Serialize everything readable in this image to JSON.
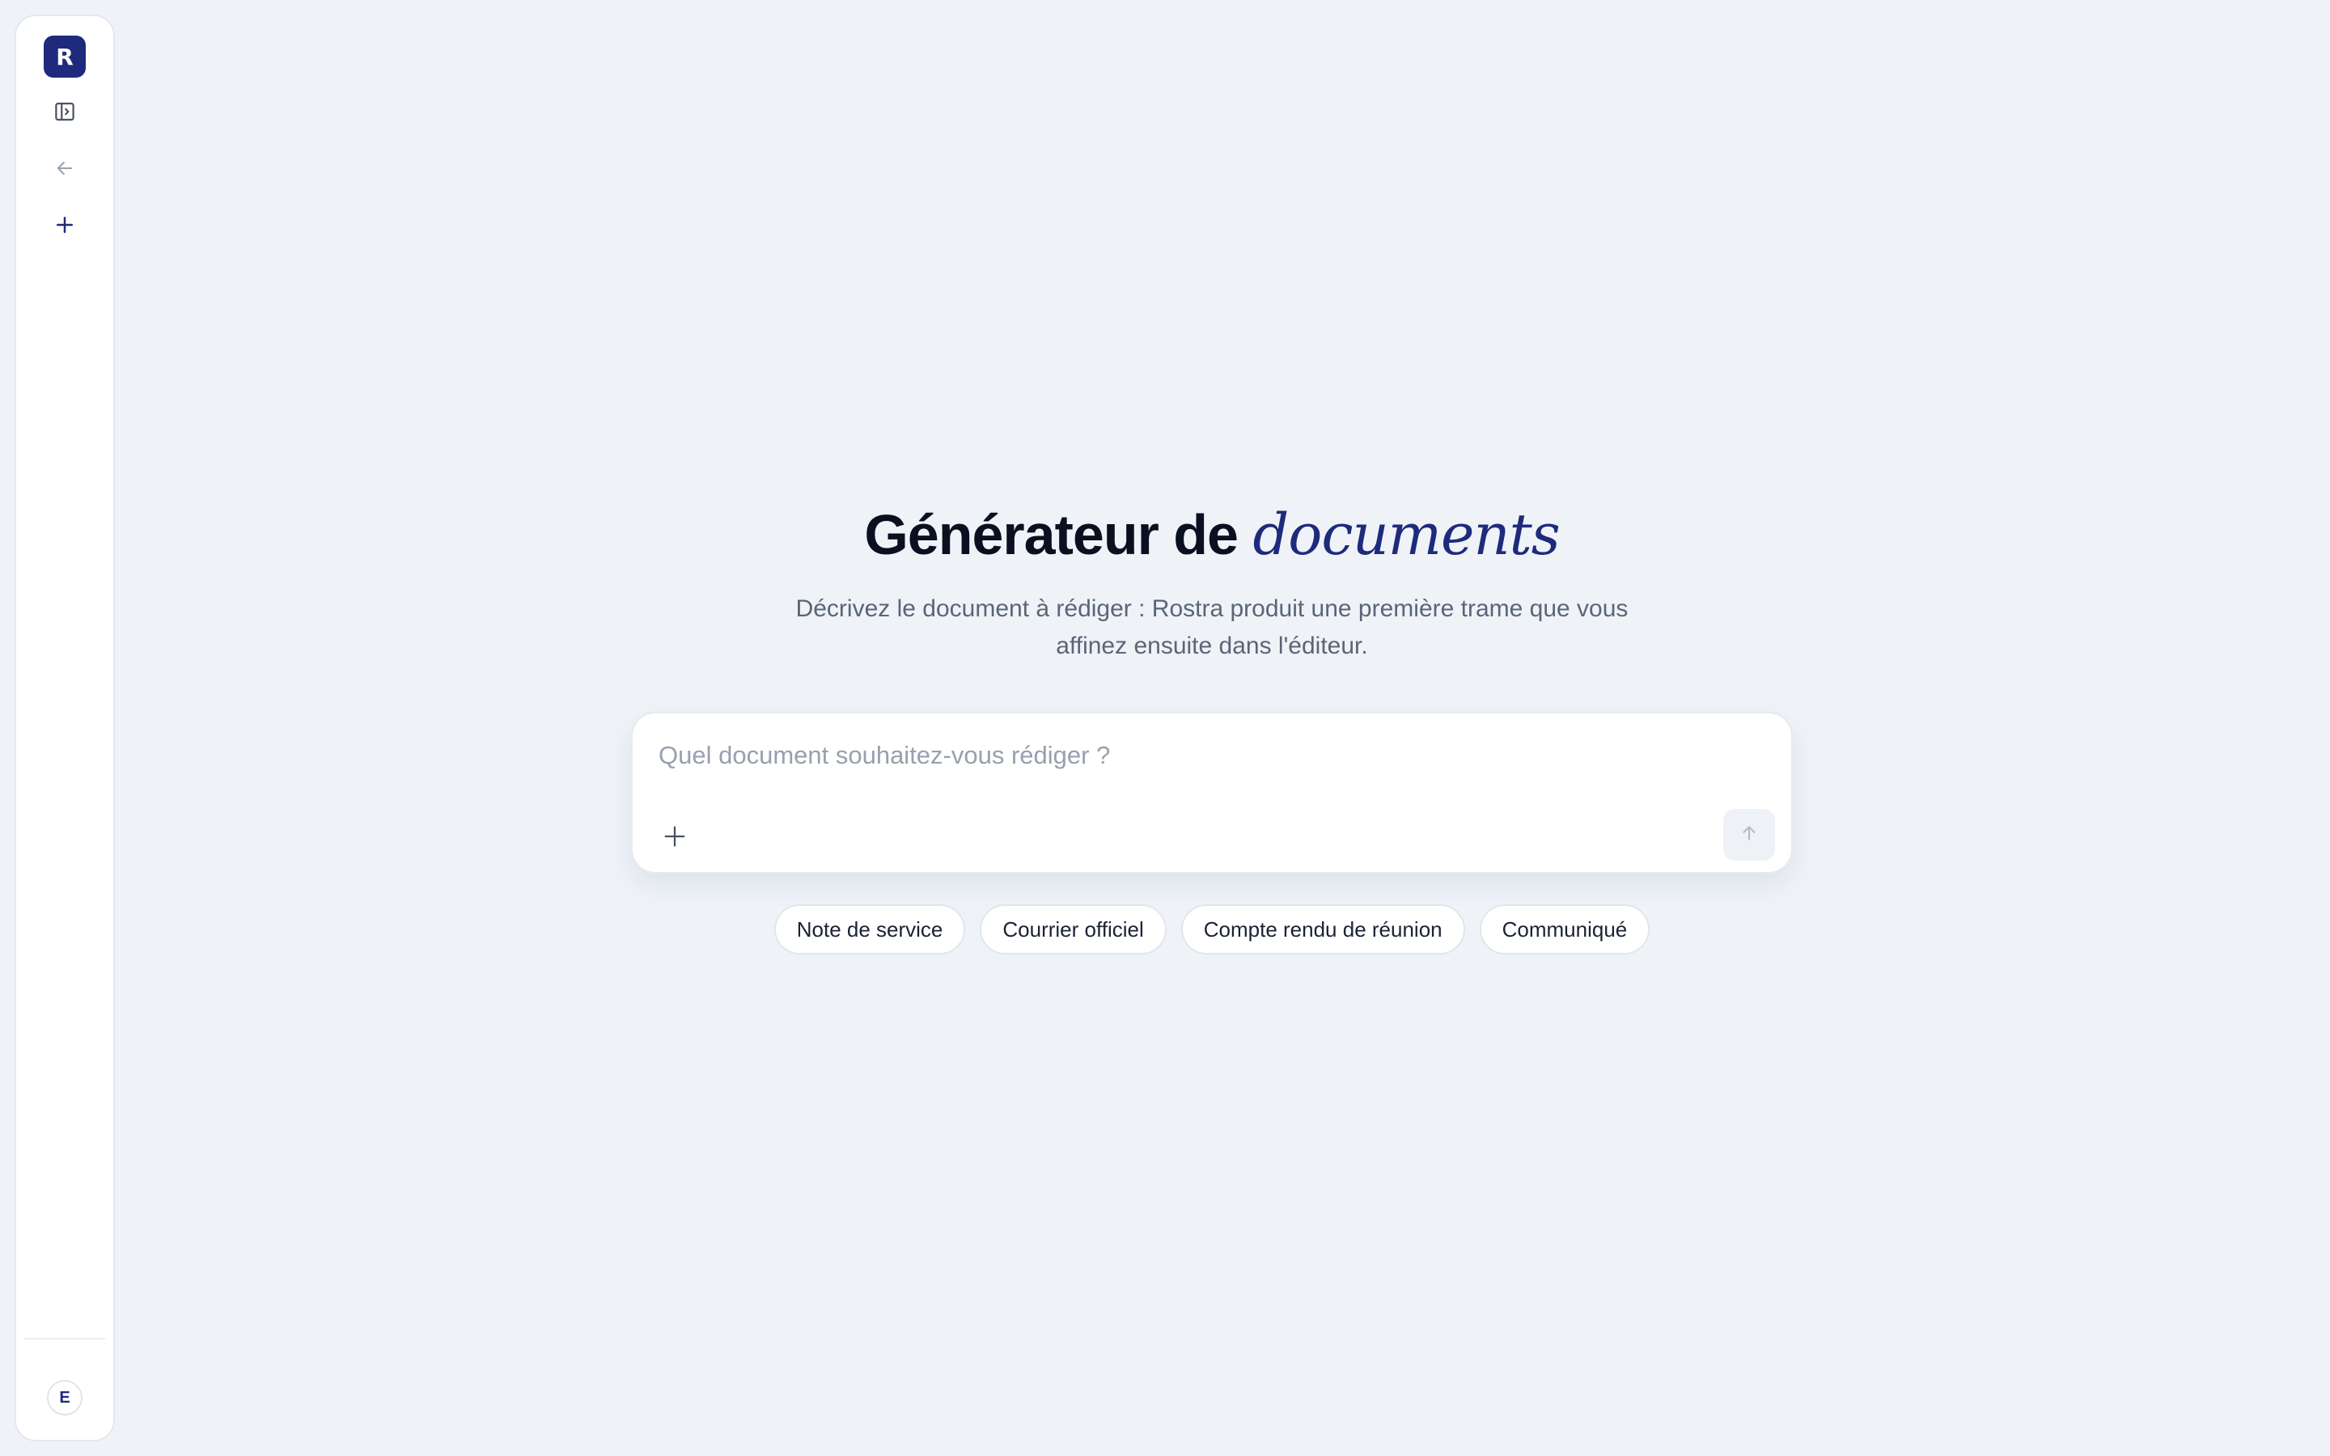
{
  "sidebar": {
    "logo_letter": "R",
    "toggle_icon": "sidebar-toggle-icon",
    "back_icon": "arrow-left-icon",
    "new_icon": "plus-icon",
    "avatar_initial": "E"
  },
  "hero": {
    "title_main": "Générateur de ",
    "title_accent": "documents",
    "subtitle": "Décrivez le document à rédiger : Rostra produit une première trame que vous affinez ensuite dans l'éditeur."
  },
  "composer": {
    "placeholder": "Quel document souhaitez-vous rédiger ?",
    "value": "",
    "attach_icon": "plus-icon",
    "send_icon": "arrow-up-icon"
  },
  "suggestions": [
    {
      "label": "Note de service"
    },
    {
      "label": "Courrier officiel"
    },
    {
      "label": "Compte rendu de réunion"
    },
    {
      "label": "Communiqué"
    }
  ],
  "colors": {
    "background": "#eff3f8",
    "brand": "#1e2a7b",
    "text_primary": "#0b1020",
    "text_secondary": "#5a6577"
  }
}
